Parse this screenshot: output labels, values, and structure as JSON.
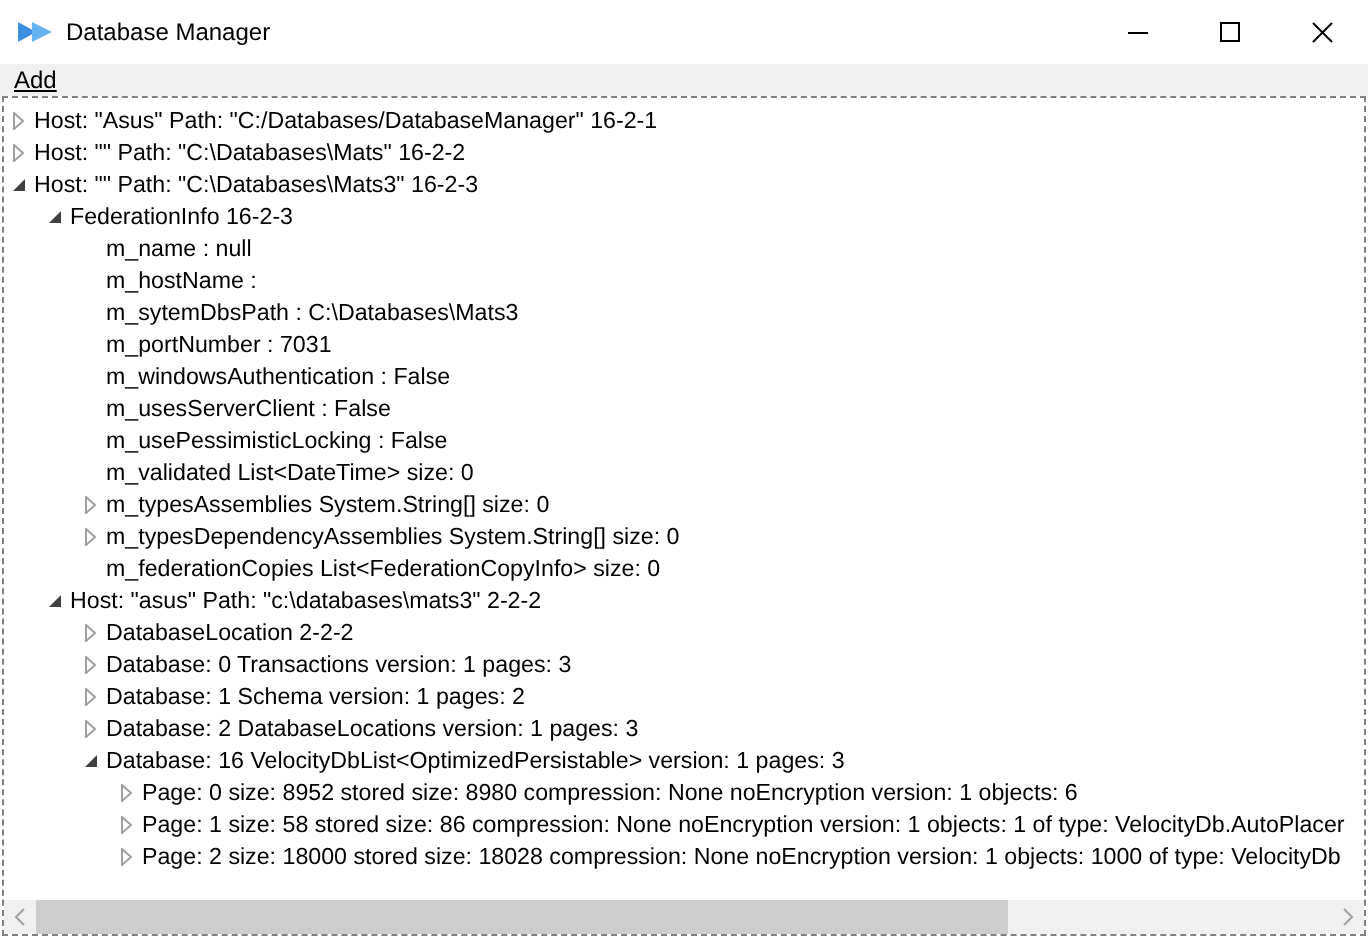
{
  "window": {
    "title": "Database Manager"
  },
  "menu": [
    {
      "label": "Add",
      "accelerator_underlined": true
    }
  ],
  "tree": [
    {
      "label": "Host: \"Asus\" Path: \"C:/Databases/DatabaseManager\" 16-2-1",
      "kind": "branch",
      "expanded": false
    },
    {
      "label": "Host: \"\" Path: \"C:\\Databases\\Mats\" 16-2-2",
      "kind": "branch",
      "expanded": false
    },
    {
      "label": "Host: \"\" Path: \"C:\\Databases\\Mats3\" 16-2-3",
      "kind": "branch",
      "expanded": true,
      "children": [
        {
          "label": "FederationInfo 16-2-3",
          "kind": "branch",
          "expanded": true,
          "children": [
            {
              "label": "m_name : null",
              "kind": "leaf"
            },
            {
              "label": "m_hostName :",
              "kind": "leaf"
            },
            {
              "label": "m_sytemDbsPath : C:\\Databases\\Mats3",
              "kind": "leaf"
            },
            {
              "label": "m_portNumber : 7031",
              "kind": "leaf"
            },
            {
              "label": "m_windowsAuthentication : False",
              "kind": "leaf"
            },
            {
              "label": "m_usesServerClient : False",
              "kind": "leaf"
            },
            {
              "label": "m_usePessimisticLocking : False",
              "kind": "leaf"
            },
            {
              "label": "m_validated List<DateTime> size: 0",
              "kind": "leaf"
            },
            {
              "label": "m_typesAssemblies System.String[] size: 0",
              "kind": "branch",
              "expanded": false
            },
            {
              "label": "m_typesDependencyAssemblies System.String[] size: 0",
              "kind": "branch",
              "expanded": false
            },
            {
              "label": "m_federationCopies List<FederationCopyInfo> size: 0",
              "kind": "leaf"
            }
          ]
        },
        {
          "label": "Host: \"asus\" Path: \"c:\\databases\\mats3\" 2-2-2",
          "kind": "branch",
          "expanded": true,
          "children": [
            {
              "label": "DatabaseLocation 2-2-2",
              "kind": "branch",
              "expanded": false
            },
            {
              "label": "Database: 0 Transactions version: 1 pages: 3",
              "kind": "branch",
              "expanded": false
            },
            {
              "label": "Database: 1 Schema version: 1 pages: 2",
              "kind": "branch",
              "expanded": false
            },
            {
              "label": "Database: 2 DatabaseLocations version: 1 pages: 3",
              "kind": "branch",
              "expanded": false
            },
            {
              "label": "Database: 16 VelocityDbList<OptimizedPersistable> version: 1 pages: 3",
              "kind": "branch",
              "expanded": true,
              "children": [
                {
                  "label": "Page: 0 size: 8952 stored size: 8980 compression: None noEncryption version: 1 objects: 6",
                  "kind": "branch",
                  "expanded": false
                },
                {
                  "label": "Page: 1 size: 58 stored size: 86 compression: None noEncryption version: 1 objects: 1 of type: VelocityDb.AutoPlacer",
                  "kind": "branch",
                  "expanded": false
                },
                {
                  "label": "Page: 2 size: 18000 stored size: 18028 compression: None noEncryption version: 1 objects: 1000 of type: VelocityDb",
                  "kind": "branch",
                  "expanded": false
                }
              ]
            }
          ]
        }
      ]
    }
  ]
}
